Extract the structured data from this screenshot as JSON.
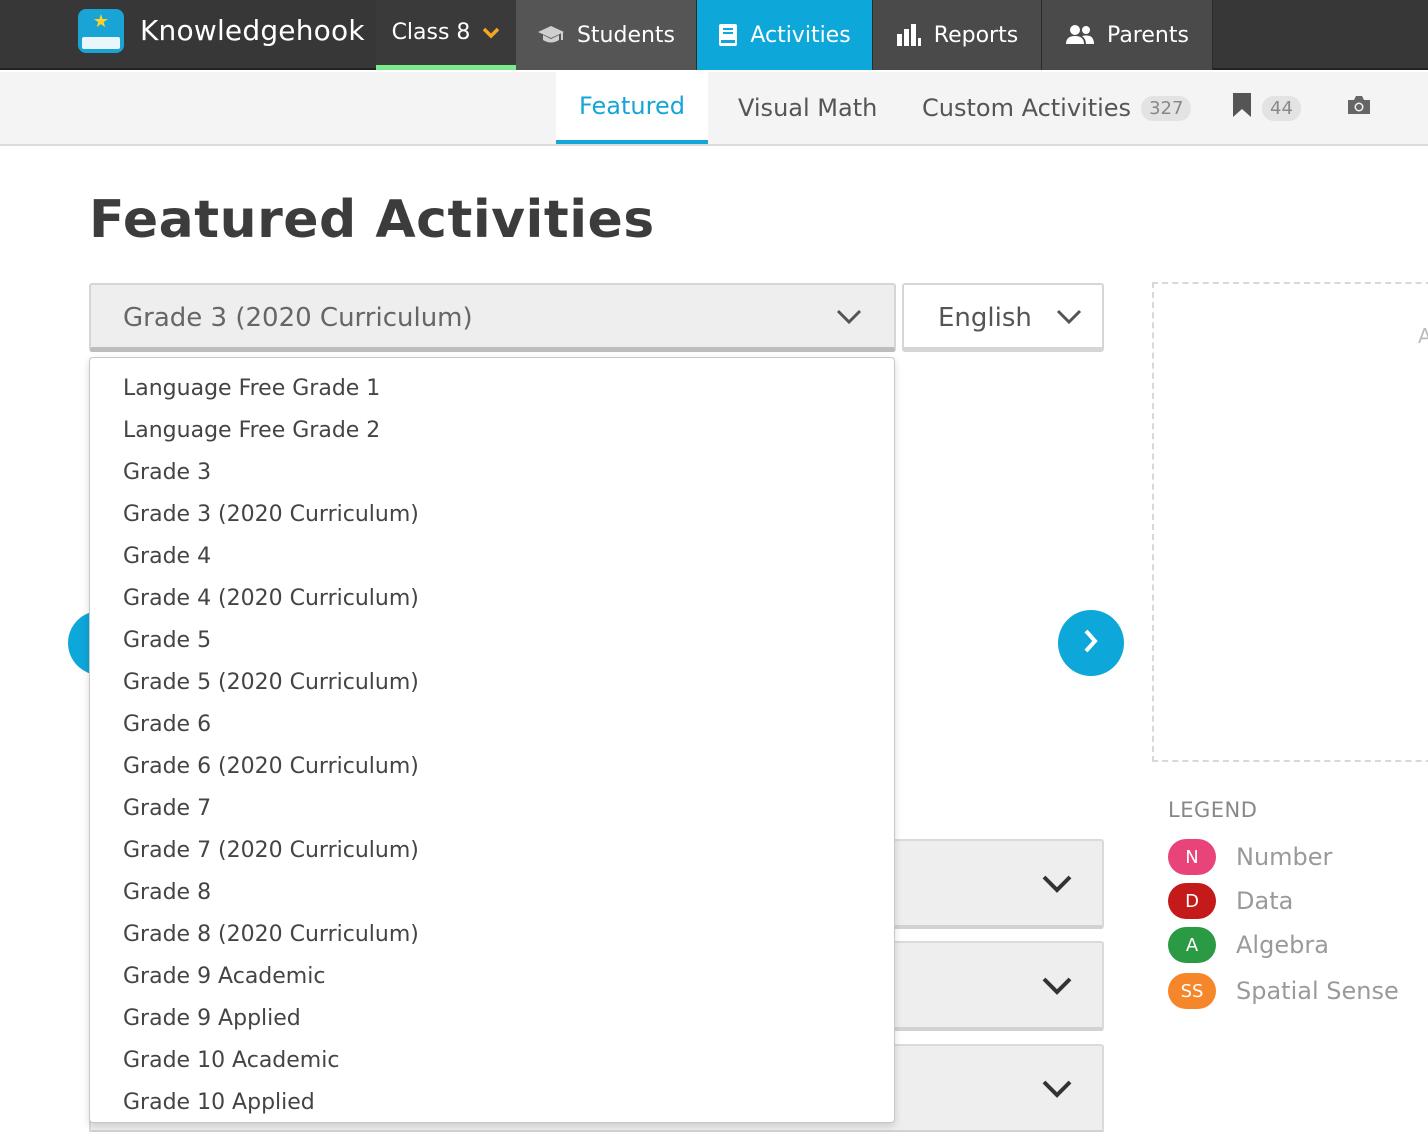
{
  "topnav": {
    "brand": "Knowledgehook",
    "class_selector": "Class 8",
    "items": [
      {
        "label": "Students",
        "icon": "graduation-cap-icon"
      },
      {
        "label": "Activities",
        "icon": "book-icon"
      },
      {
        "label": "Reports",
        "icon": "bar-chart-icon"
      },
      {
        "label": "Parents",
        "icon": "users-icon"
      }
    ]
  },
  "subnav": {
    "tabs": [
      {
        "label": "Featured"
      },
      {
        "label": "Visual Math"
      },
      {
        "label": "Custom Activities",
        "count": "327"
      }
    ],
    "bookmark_count": "44"
  },
  "page": {
    "title": "Featured Activities",
    "grade_select": {
      "value": "Grade 3 (2020 Curriculum)",
      "options": [
        "Language Free Grade 1",
        "Language Free Grade 2",
        "Grade 3",
        "Grade 3 (2020 Curriculum)",
        "Grade 4",
        "Grade 4 (2020 Curriculum)",
        "Grade 5",
        "Grade 5 (2020 Curriculum)",
        "Grade 6",
        "Grade 6 (2020 Curriculum)",
        "Grade 7",
        "Grade 7 (2020 Curriculum)",
        "Grade 8",
        "Grade 8 (2020 Curriculum)",
        "Grade 9 Academic",
        "Grade 9 Applied",
        "Grade 10 Academic",
        "Grade 10 Applied"
      ]
    },
    "language_select": {
      "value": "English"
    },
    "panel_cut_text": "A"
  },
  "legend": {
    "title": "LEGEND",
    "items": [
      {
        "code": "N",
        "label": "Number",
        "color": "#e8447a"
      },
      {
        "code": "D",
        "label": "Data",
        "color": "#c41a1a"
      },
      {
        "code": "A",
        "label": "Algebra",
        "color": "#2a9a45"
      },
      {
        "code": "SS",
        "label": "Spatial Sense",
        "color": "#f5862a"
      }
    ]
  },
  "colors": {
    "accent": "#0ea7d9",
    "nav_bg": "#373737",
    "class_underline": "#7bea8c"
  }
}
